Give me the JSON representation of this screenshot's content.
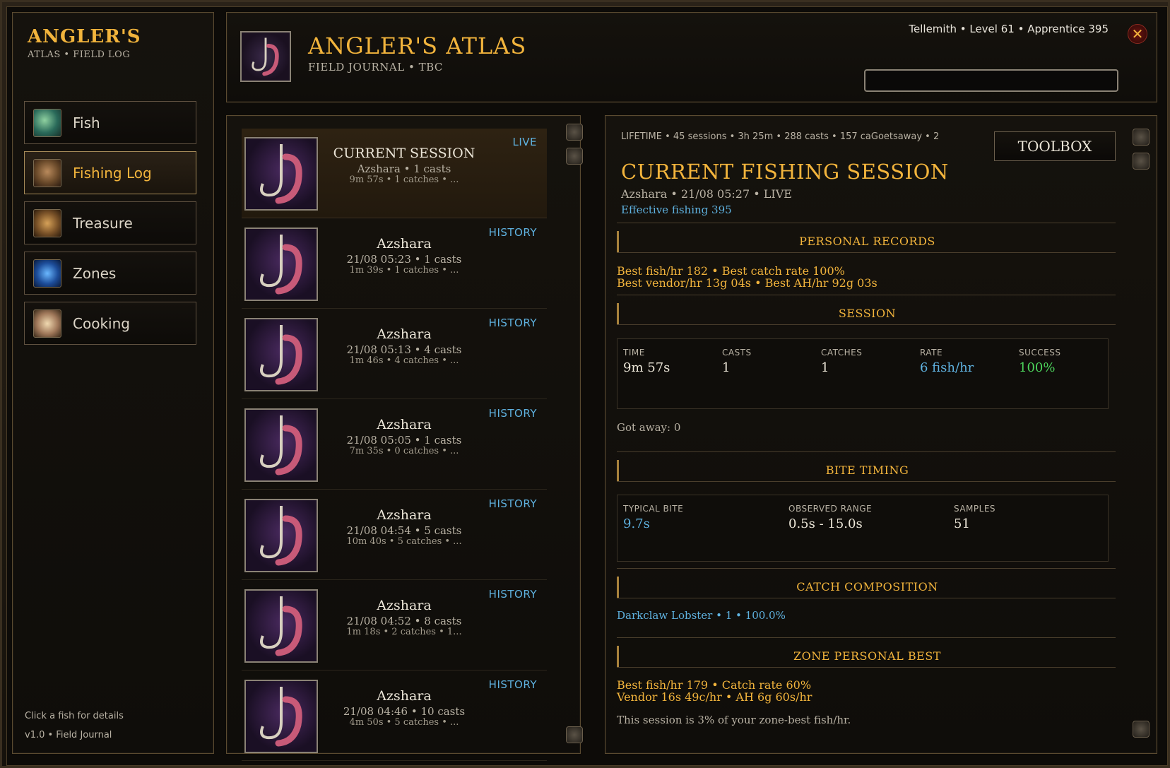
{
  "sidebar": {
    "title": "ANGLER'S",
    "subtitle": "ATLAS  •  FIELD LOG",
    "items": [
      {
        "label": "Fish",
        "icon": "fish-icon"
      },
      {
        "label": "Fishing Log",
        "icon": "log-icon",
        "active": true
      },
      {
        "label": "Treasure",
        "icon": "treasure-icon"
      },
      {
        "label": "Zones",
        "icon": "zones-icon"
      },
      {
        "label": "Cooking",
        "icon": "cooking-icon"
      }
    ],
    "hint": "Click a fish for details",
    "version": "v1.0  •  Field Journal"
  },
  "header": {
    "title": "ANGLER'S ATLAS",
    "subtitle": "FIELD JOURNAL  •  TBC",
    "status": "Tellemith  •  Level 61  •  Apprentice 395",
    "search_value": "",
    "close_icon": "close-icon"
  },
  "sessions": [
    {
      "title": "CURRENT SESSION",
      "line1": "Azshara  •  1 casts",
      "line2": "9m 57s  •  1 catches  •  ...",
      "tag": "LIVE"
    },
    {
      "title": "Azshara",
      "line1": "21/08 05:23  •  1 casts",
      "line2": "1m 39s  •  1 catches  •  ...",
      "tag": "HISTORY"
    },
    {
      "title": "Azshara",
      "line1": "21/08 05:13  •  4 casts",
      "line2": "1m 46s  •  4 catches  •  ...",
      "tag": "HISTORY"
    },
    {
      "title": "Azshara",
      "line1": "21/08 05:05  •  1 casts",
      "line2": "7m 35s  •  0 catches  •  ...",
      "tag": "HISTORY"
    },
    {
      "title": "Azshara",
      "line1": "21/08 04:54  •  5 casts",
      "line2": "10m 40s  •  5 catches  •  ...",
      "tag": "HISTORY"
    },
    {
      "title": "Azshara",
      "line1": "21/08 04:52  •  8 casts",
      "line2": "1m 18s  •  2 catches  •  1...",
      "tag": "HISTORY"
    },
    {
      "title": "Azshara",
      "line1": "21/08 04:46  •  10 casts",
      "line2": "4m 50s  •  5 catches  •  ...",
      "tag": "HISTORY"
    }
  ],
  "detail": {
    "lifetime": "LIFETIME  •  45 sessions  •  3h 25m  •  288 casts  •  157 caGoetsaway  •  2",
    "toolbox": "TOOLBOX",
    "title": "CURRENT FISHING SESSION",
    "subtitle": "Azshara  •  21/08 05:27  •  LIVE",
    "effective": "Effective fishing 395",
    "records": {
      "heading": "PERSONAL RECORDS",
      "line1": "Best fish/hr  182  •  Best catch rate  100%",
      "line2": "Best vendor/hr  13g 04s  •  Best AH/hr  92g 03s"
    },
    "session": {
      "heading": "SESSION",
      "stats": [
        {
          "label": "TIME",
          "value": "9m 57s"
        },
        {
          "label": "CASTS",
          "value": "1"
        },
        {
          "label": "CATCHES",
          "value": "1"
        },
        {
          "label": "RATE",
          "value": "6 fish/hr"
        },
        {
          "label": "SUCCESS",
          "value": "100%"
        }
      ],
      "got_away": "Got away: 0"
    },
    "bite": {
      "heading": "BITE TIMING",
      "stats": [
        {
          "label": "TYPICAL BITE",
          "value": "9.7s"
        },
        {
          "label": "OBSERVED RANGE",
          "value": "0.5s - 15.0s"
        },
        {
          "label": "SAMPLES",
          "value": "51"
        }
      ]
    },
    "catch": {
      "heading": "CATCH COMPOSITION",
      "line": "Darkclaw Lobster  •  1  •  100.0%"
    },
    "zone_best": {
      "heading": "ZONE PERSONAL BEST",
      "line1": "Best fish/hr  179  •  Catch rate  60%",
      "line2": "Vendor  16s 49c/hr  •  AH  6g 60s/hr",
      "note": "This session is 3% of your zone-best fish/hr."
    }
  },
  "colors": {
    "gold": "#f2b43c",
    "blue": "#5fb2e0",
    "green": "#4cd45c"
  }
}
